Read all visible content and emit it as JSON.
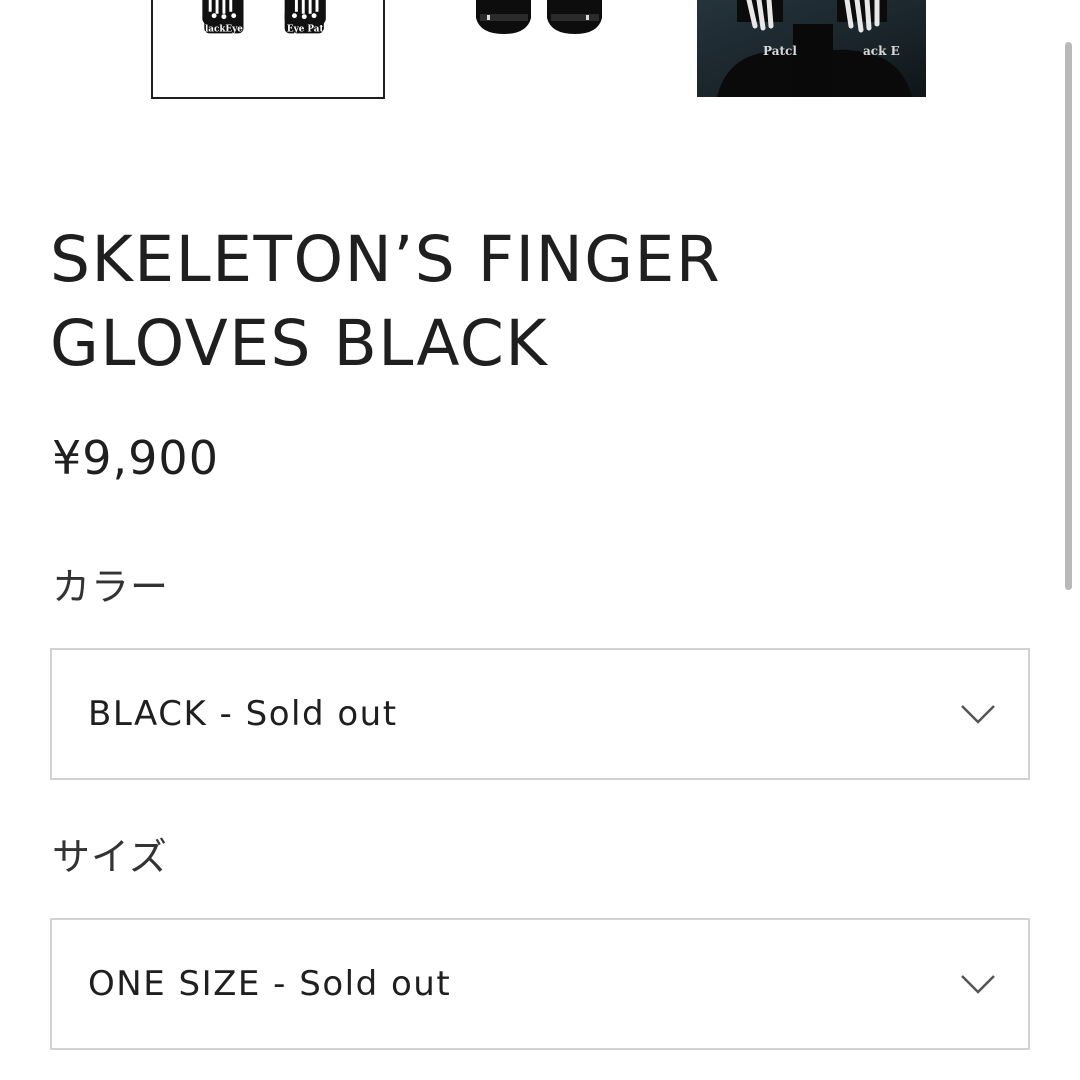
{
  "gallery": {
    "thumbnails": [
      {
        "name": "product-thumbnail-1",
        "text_left": "lackEye",
        "text_right": "Eye Pat"
      },
      {
        "name": "product-thumbnail-2"
      },
      {
        "name": "product-thumbnail-3",
        "text_left": "Patcl",
        "text_right": "ack E"
      }
    ]
  },
  "product": {
    "title_line1": "SKELETON’S FINGER",
    "title_line2": "GLOVES BLACK",
    "price": "¥9,900"
  },
  "options": {
    "color": {
      "label": "カラー",
      "selected": "BLACK - Sold out"
    },
    "size": {
      "label": "サイズ",
      "selected": "ONE SIZE - Sold out"
    }
  },
  "icons": {
    "dropdown": "chevron-down-icon"
  },
  "colors": {
    "text": "#1f1f1f",
    "border": "#d2d2d2",
    "selected_thumbnail_border": "#1f1f1f",
    "scrollbar": "#b9b9b9"
  }
}
